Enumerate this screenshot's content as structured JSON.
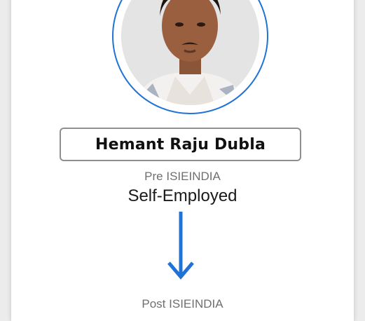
{
  "profile": {
    "name": "Hemant Raju Dubla",
    "photo": "profile-photo",
    "pre_label": "Pre ISIEINDIA",
    "pre_value": "Self-Employed",
    "post_label": "Post ISIEINDIA"
  },
  "colors": {
    "accent": "#1f73d6",
    "card_bg": "#ffffff",
    "page_bg": "#ececec",
    "name_border": "#8f8f8f"
  },
  "icons": {
    "transition": "down-arrow-icon"
  }
}
